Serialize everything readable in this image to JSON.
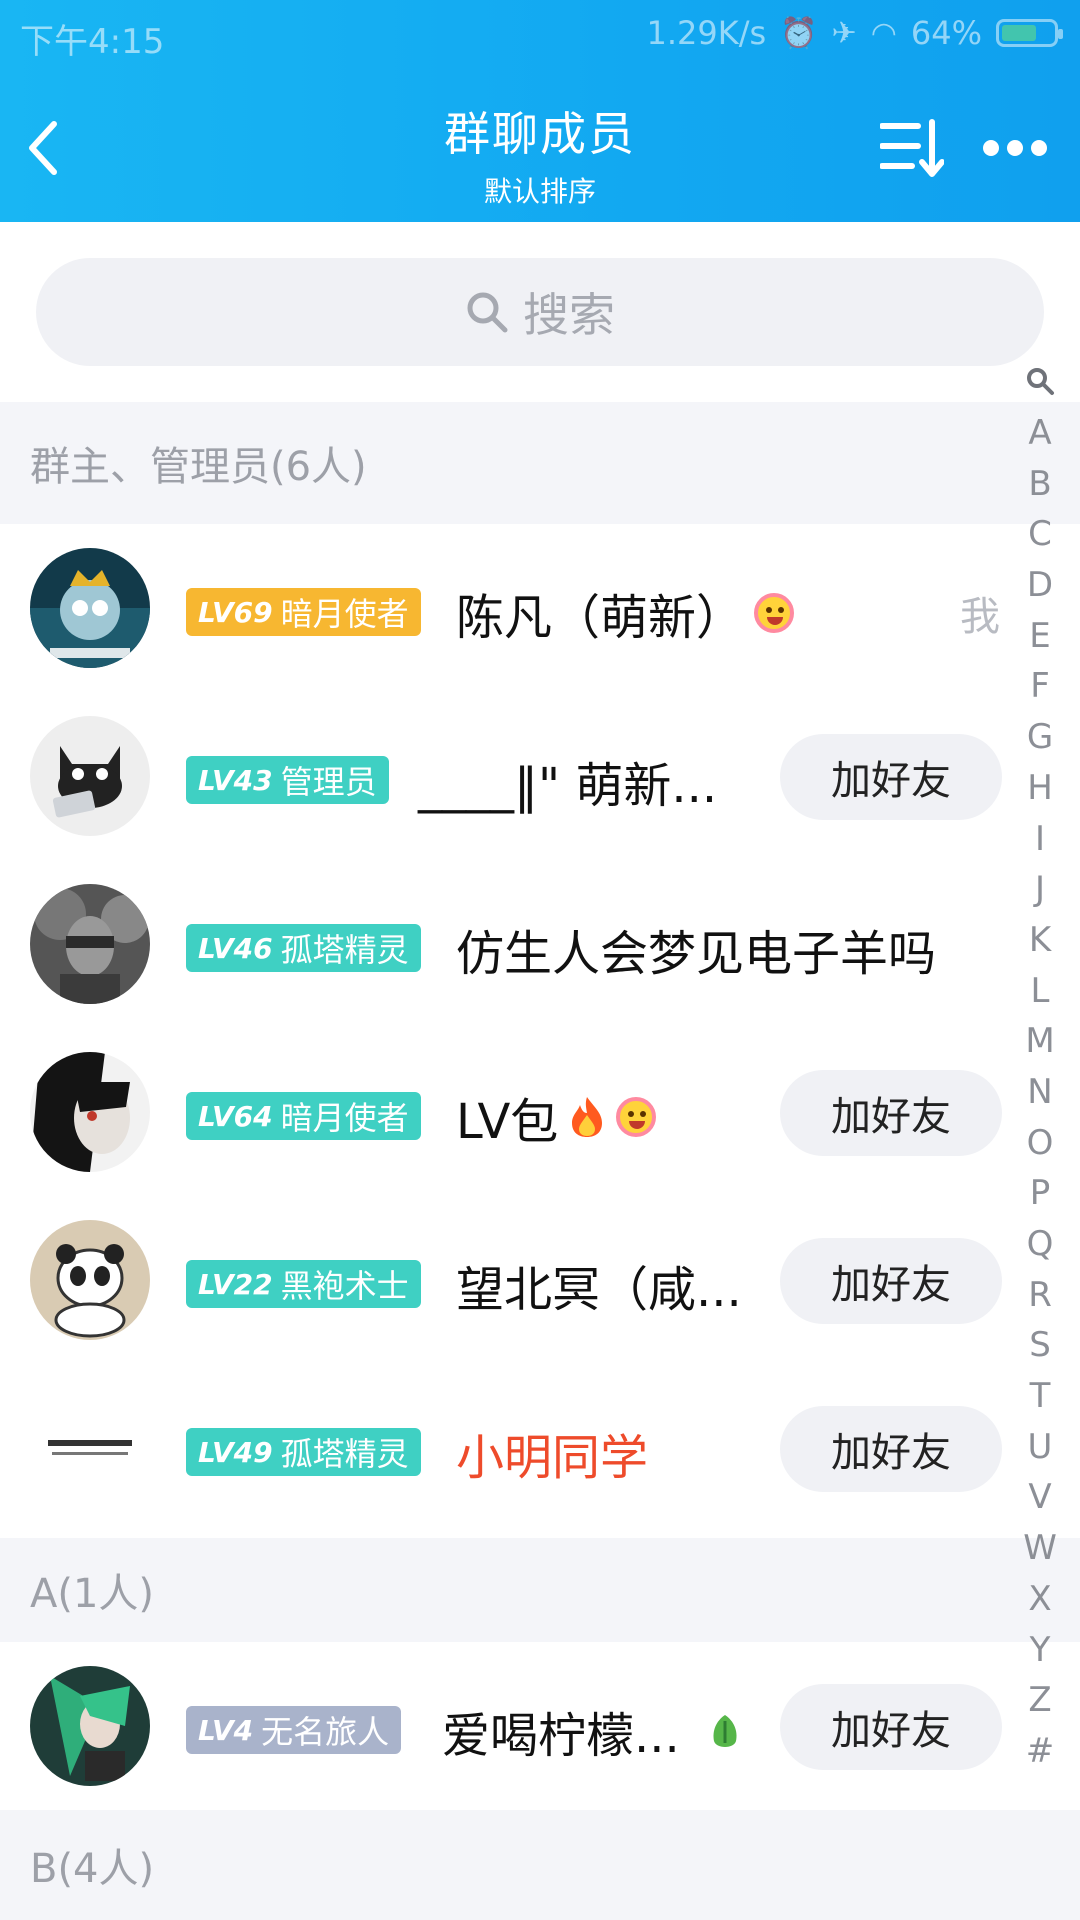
{
  "status": {
    "time": "下午4:15",
    "speed": "1.29K/s",
    "battery": "64%",
    "battery_level": 0.64
  },
  "header": {
    "title": "群聊成员",
    "subtitle": "默认排序"
  },
  "search": {
    "placeholder": "搜索"
  },
  "sections": [
    {
      "title": "群主、管理员(6人)"
    },
    {
      "title": "A(1人)"
    },
    {
      "title": "B(4人)"
    }
  ],
  "members": [
    {
      "lv": "LV69",
      "role": "暗月使者",
      "name": "陈凡（萌新）",
      "action": "我",
      "badge_color": "#f7b731"
    },
    {
      "lv": "LV43",
      "role": "管理员",
      "name": "____‖\" 萌新...",
      "action": "加好友",
      "badge_color": "#3fd0c3"
    },
    {
      "lv": "LV46",
      "role": "孤塔精灵",
      "name": "仿生人会梦见电子羊吗",
      "action": "",
      "badge_color": "#3fd0c3"
    },
    {
      "lv": "LV64",
      "role": "暗月使者",
      "name": "LV包",
      "action": "加好友",
      "badge_color": "#3fd0c3"
    },
    {
      "lv": "LV22",
      "role": "黑袍术士",
      "name": "望北冥（咸...",
      "action": "加好友",
      "badge_color": "#3fd0c3"
    },
    {
      "lv": "LV49",
      "role": "孤塔精灵",
      "name": "小明同学",
      "action": "加好友",
      "badge_color": "#3fd0c3",
      "name_color": "#ee4b2b"
    },
    {
      "lv": "LV4",
      "role": "无名旅人",
      "name": "爱喝柠檬...",
      "action": "加好友",
      "badge_color": "#a9b3cb"
    }
  ],
  "index_letters": [
    "A",
    "B",
    "C",
    "D",
    "E",
    "F",
    "G",
    "H",
    "I",
    "J",
    "K",
    "L",
    "M",
    "N",
    "O",
    "P",
    "Q",
    "R",
    "S",
    "T",
    "U",
    "V",
    "W",
    "X",
    "Y",
    "Z",
    "#"
  ],
  "colors": {
    "header": "#15aef2",
    "accent_red": "#ee4b2b"
  }
}
